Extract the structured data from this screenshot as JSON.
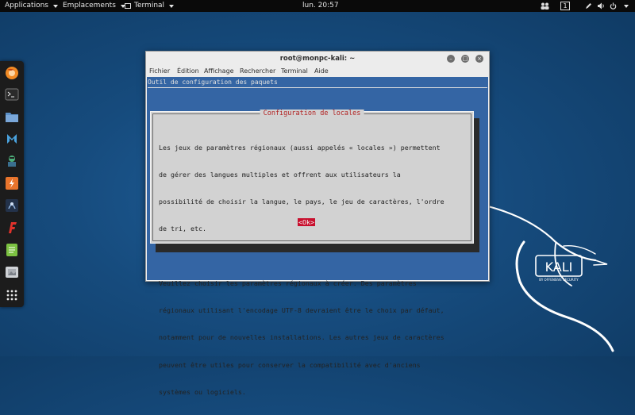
{
  "topbar": {
    "applications": "Applications",
    "places": "Emplacements",
    "terminal_app": "Terminal",
    "clock": "lun. 20:57",
    "workspace": "1"
  },
  "dock": {
    "items": [
      "firefox-icon",
      "terminal-icon",
      "files-icon",
      "metasploit-icon",
      "armitage-icon",
      "burpsuite-icon",
      "beef-icon",
      "faraday-icon",
      "leafpad-icon",
      "gallery-icon",
      "show-apps-icon"
    ]
  },
  "window": {
    "title": "root@monpc-kali: ~",
    "menu": [
      "Fichier",
      "Édition",
      "Affichage",
      "Rechercher",
      "Terminal",
      "Aide"
    ]
  },
  "terminal": {
    "header": "Outil de configuration des paquets",
    "dialog_title": "Configuration de locales",
    "body": [
      "Les jeux de paramètres régionaux (aussi appelés « locales ») permettent",
      "de gérer des langues multiples et offrent aux utilisateurs la",
      "possibilité de choisir la langue, le pays, le jeu de caractères, l'ordre",
      "de tri, etc.",
      "",
      "Veuillez choisir les paramètres régionaux à créer. Des paramètres",
      "régionaux utilisant l'encodage UTF-8 devraient être le choix par défaut,",
      "notamment pour de nouvelles installations. Les autres jeux de caractères",
      "peuvent être utiles pour conserver la compatibilité avec d'anciens",
      "systèmes ou logiciels."
    ],
    "ok_label": "<Ok>"
  },
  "logo": {
    "text": "KALI",
    "subtext": "BY OFFENSIVE SECURITY"
  },
  "colors": {
    "terminal_bg": "#3465a4",
    "dialog_bg": "#d2d2d2",
    "accent_red": "#c8102e"
  }
}
